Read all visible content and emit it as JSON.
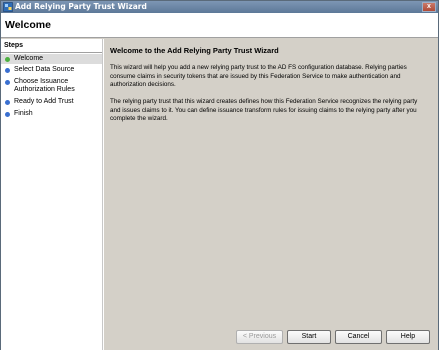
{
  "window": {
    "title": "Add Relying Party Trust Wizard",
    "close_glyph": "x"
  },
  "header": {
    "title": "Welcome"
  },
  "steps": {
    "title": "Steps",
    "items": [
      {
        "label": "Welcome",
        "status": "current"
      },
      {
        "label": "Select Data Source",
        "status": "pending"
      },
      {
        "label": "Choose Issuance Authorization Rules",
        "status": "pending"
      },
      {
        "label": "Ready to Add Trust",
        "status": "pending"
      },
      {
        "label": "Finish",
        "status": "pending"
      }
    ]
  },
  "main": {
    "title": "Welcome to the Add Relying Party Trust Wizard",
    "paragraph1": "This wizard will help you add a new relying party trust to the AD FS configuration database.  Relying parties consume claims in security tokens that are issued by this Federation Service to make authentication and authorization decisions.",
    "paragraph2": "The relying party trust that this wizard creates defines how this Federation Service recognizes the relying party and issues claims to it. You can define issuance transform rules for issuing claims to the relying party after you complete the wizard."
  },
  "buttons": {
    "previous": "< Previous",
    "start": "Start",
    "cancel": "Cancel",
    "help": "Help"
  },
  "colors": {
    "current_step_dot": "#4cb040",
    "pending_step_dot": "#3a6fd0"
  }
}
